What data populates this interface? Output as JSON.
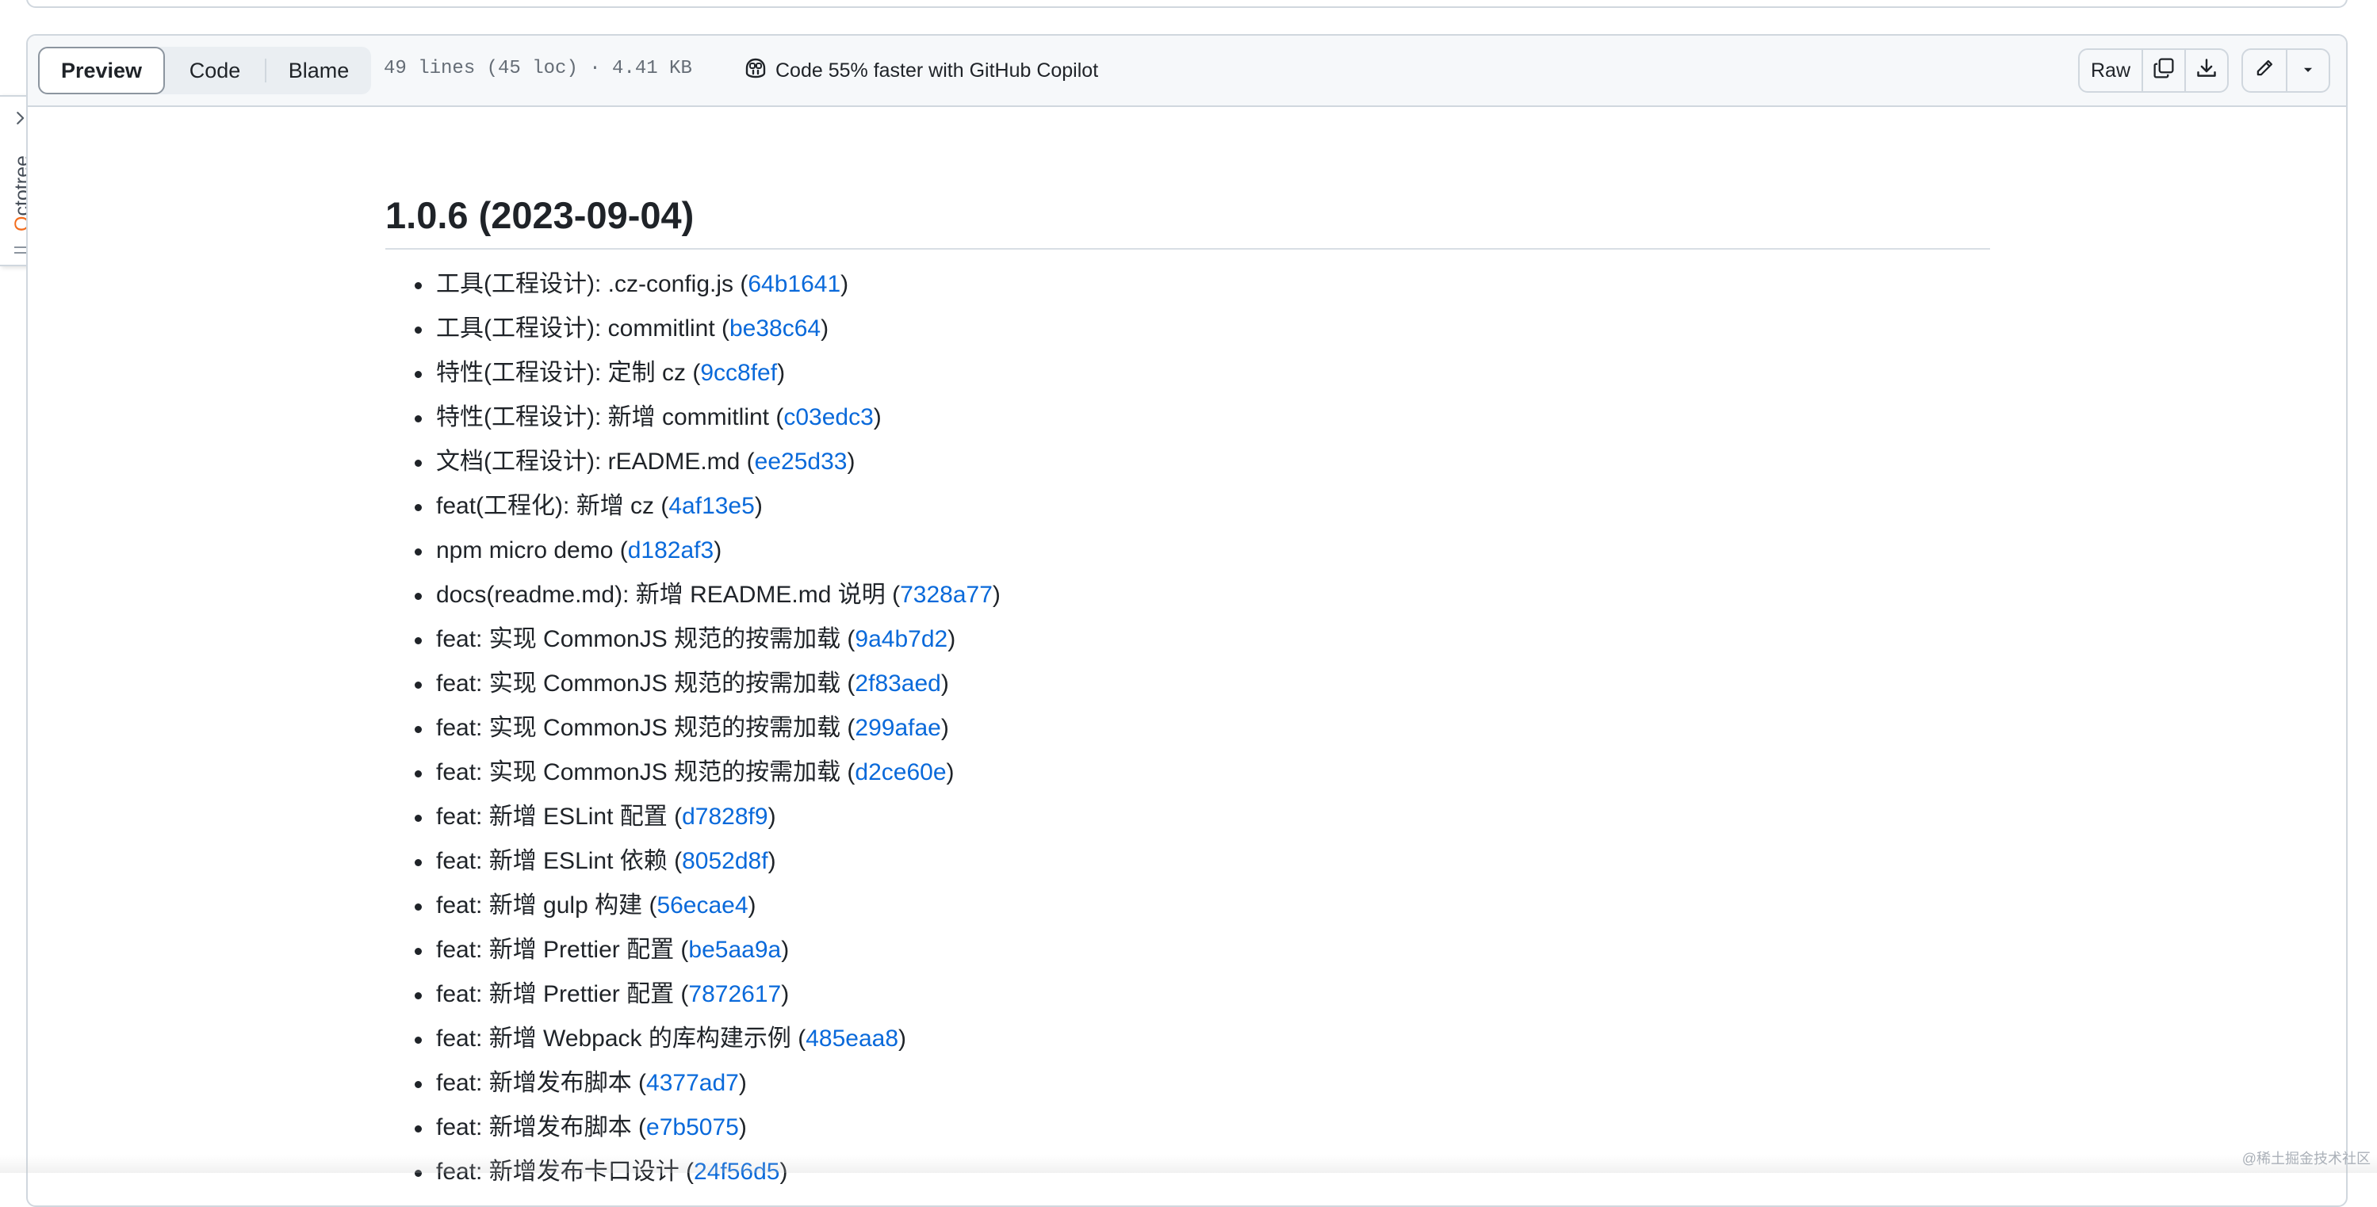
{
  "file_header": {
    "tabs": [
      {
        "label": "Preview",
        "active": true
      },
      {
        "label": "Code",
        "active": false
      },
      {
        "label": "Blame",
        "active": false
      }
    ],
    "file_meta": "49 lines (45 loc) · 4.41 KB",
    "copilot_label": "Code 55% faster with GitHub Copilot",
    "raw_label": "Raw"
  },
  "octotree": {
    "label_first": "O",
    "label_rest": "ctotree"
  },
  "release": {
    "title": "1.0.6 (2023-09-04)",
    "commits": [
      {
        "text": "工具(工程设计): .cz-config.js",
        "hash": "64b1641"
      },
      {
        "text": "工具(工程设计): commitlint",
        "hash": "be38c64"
      },
      {
        "text": "特性(工程设计): 定制 cz",
        "hash": "9cc8fef"
      },
      {
        "text": "特性(工程设计): 新增 commitlint",
        "hash": "c03edc3"
      },
      {
        "text": "文档(工程设计): rEADME.md",
        "hash": "ee25d33"
      },
      {
        "text": "feat(工程化): 新增 cz",
        "hash": "4af13e5"
      },
      {
        "text": "npm micro demo",
        "hash": "d182af3"
      },
      {
        "text": "docs(readme.md): 新增 README.md 说明",
        "hash": "7328a77"
      },
      {
        "text": "feat: 实现 CommonJS 规范的按需加载",
        "hash": "9a4b7d2"
      },
      {
        "text": "feat: 实现 CommonJS 规范的按需加载",
        "hash": "2f83aed"
      },
      {
        "text": "feat: 实现 CommonJS 规范的按需加载",
        "hash": "299afae"
      },
      {
        "text": "feat: 实现 CommonJS 规范的按需加载",
        "hash": "d2ce60e"
      },
      {
        "text": "feat: 新增 ESLint 配置",
        "hash": "d7828f9"
      },
      {
        "text": "feat: 新增 ESLint 依赖",
        "hash": "8052d8f"
      },
      {
        "text": "feat: 新增 gulp 构建",
        "hash": "56ecae4"
      },
      {
        "text": "feat: 新增 Prettier 配置",
        "hash": "be5aa9a"
      },
      {
        "text": "feat: 新增 Prettier 配置",
        "hash": "7872617"
      },
      {
        "text": "feat: 新增 Webpack 的库构建示例",
        "hash": "485eaa8"
      },
      {
        "text": "feat: 新增发布脚本",
        "hash": "4377ad7"
      },
      {
        "text": "feat: 新增发布脚本",
        "hash": "e7b5075"
      },
      {
        "text": "feat: 新增发布卡口设计",
        "hash": "24f56d5"
      }
    ]
  },
  "watermark": "@稀土掘金技术社区",
  "colors": {
    "link": "#0969da",
    "text": "#1f2328",
    "border": "#d0d7de",
    "header_bg": "#f6f8fa",
    "octotree_accent": "#f36c1c"
  }
}
